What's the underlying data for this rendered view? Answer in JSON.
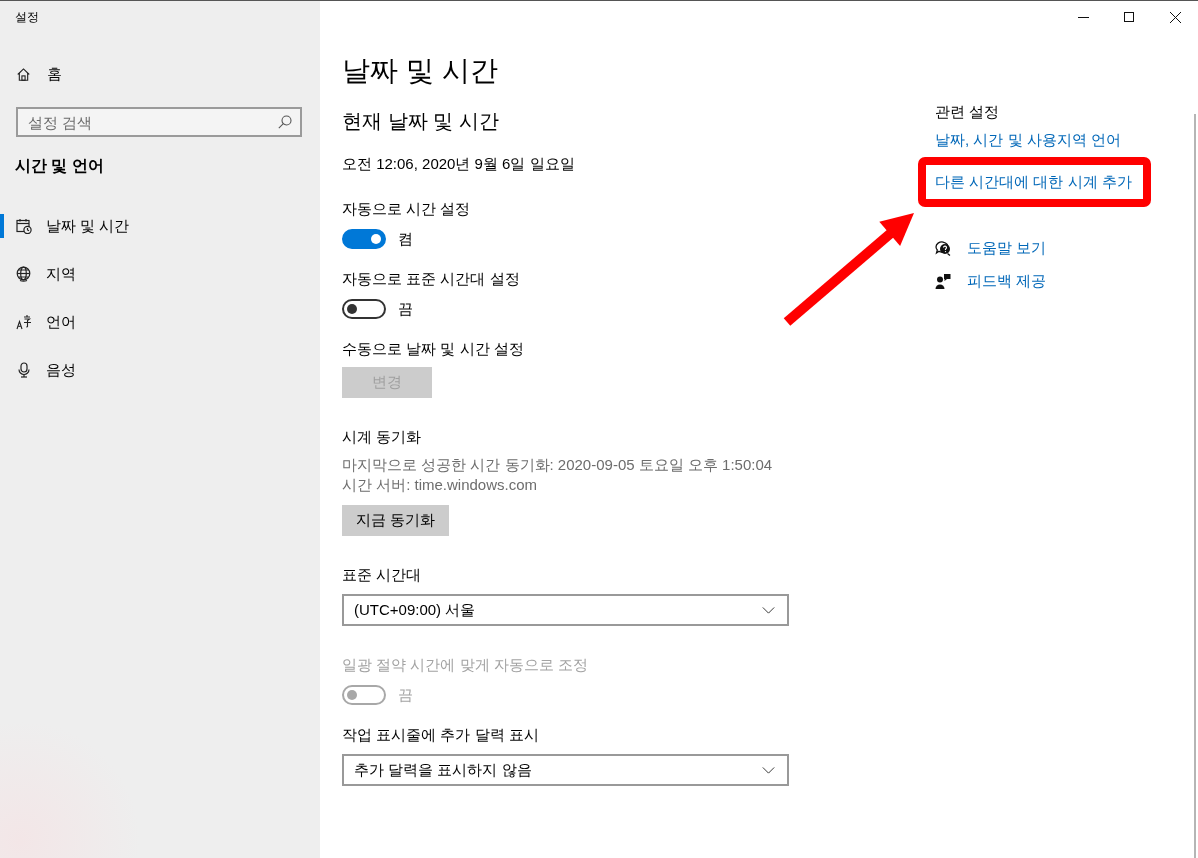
{
  "window": {
    "title": "설정"
  },
  "sidebar": {
    "home": "홈",
    "search": {
      "placeholder": "설정 검색"
    },
    "section": "시간 및 언어",
    "items": [
      {
        "label": "날짜 및 시간",
        "selected": true
      },
      {
        "label": "지역",
        "selected": false
      },
      {
        "label": "언어",
        "selected": false
      },
      {
        "label": "음성",
        "selected": false
      }
    ]
  },
  "page": {
    "title": "날짜 및 시간",
    "subtitle": "현재 날짜 및 시간",
    "current_datetime": "오전 12:06, 2020년 9월 6일 일요일"
  },
  "settings": [
    {
      "kind": "toggle",
      "label": "자동으로 시간 설정",
      "on": true,
      "state_label": "켬",
      "disabled": false
    },
    {
      "kind": "toggle",
      "label": "자동으로 표준 시간대 설정",
      "on": false,
      "state_label": "끔",
      "disabled": false
    },
    {
      "kind": "button",
      "label": "수동으로 날짜 및 시간 설정",
      "button": "변경",
      "disabled": true
    },
    {
      "kind": "button",
      "label": "시계 동기화",
      "details": [
        "마지막으로 성공한 시간 동기화: 2020-09-05 토요일 오후 1:50:04",
        "시간 서버: time.windows.com"
      ],
      "button": "지금 동기화",
      "disabled": false
    },
    {
      "kind": "dropdown",
      "label": "표준 시간대",
      "value": "(UTC+09:00) 서울"
    },
    {
      "kind": "toggle",
      "label": "일광 절약 시간에 맞게 자동으로 조정",
      "on": false,
      "state_label": "끔",
      "disabled": true
    },
    {
      "kind": "dropdown",
      "label": "작업 표시줄에 추가 달력 표시",
      "value": "추가 달력을 표시하지 않음"
    }
  ],
  "related": {
    "title": "관련 설정",
    "links": [
      {
        "label": "날짜, 시간 및 사용지역 언어",
        "highlighted": false
      },
      {
        "label": "다른 시간대에 대한 시계 추가",
        "highlighted": true
      }
    ]
  },
  "help": [
    {
      "label": "도움말 보기"
    },
    {
      "label": "피드백 제공"
    }
  ]
}
